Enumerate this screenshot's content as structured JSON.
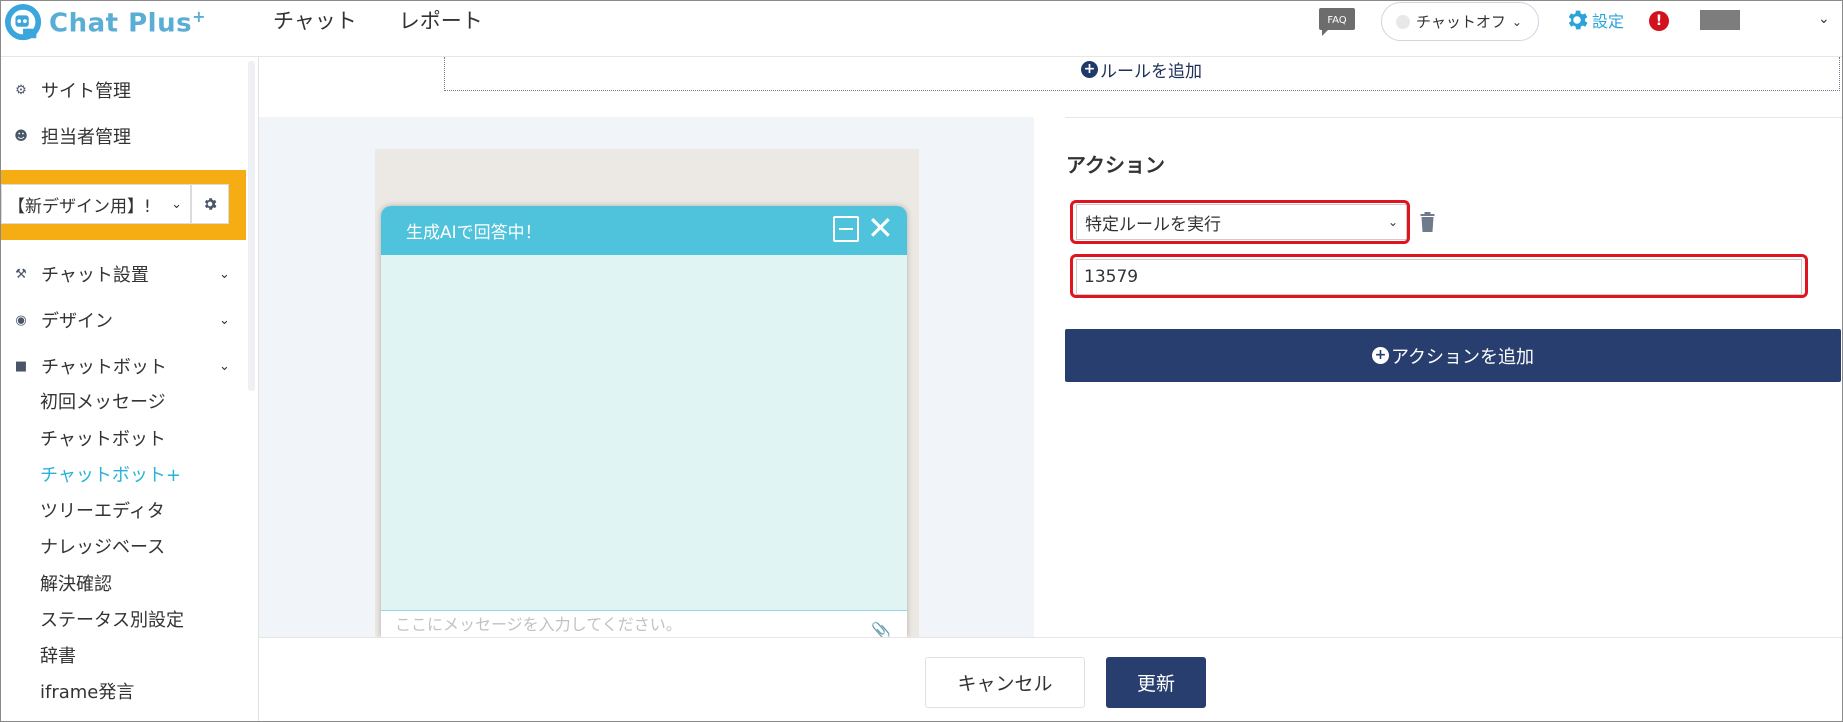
{
  "app": {
    "brand": "Chat Plus",
    "brand_sup": "+",
    "top_nav": [
      "チャット",
      "レポート"
    ],
    "faq_label": "FAQ",
    "chat_status": "チャットオフ",
    "settings_label": "設定",
    "alert_glyph": "!"
  },
  "sidebar": {
    "top_items": [
      {
        "label": "サイト管理",
        "icon": "gears-icon"
      },
      {
        "label": "担当者管理",
        "icon": "user-gear-icon"
      }
    ],
    "site_select": "【新デザイン用】!",
    "sections": [
      {
        "label": "チャット設置",
        "icon": "tools-icon"
      },
      {
        "label": "デザイン",
        "icon": "palette-icon"
      },
      {
        "label": "チャットボット",
        "icon": "chat-bubbles-icon"
      }
    ],
    "sub_items": [
      {
        "label": "初回メッセージ",
        "active": false
      },
      {
        "label": "チャットボット",
        "active": false
      },
      {
        "label": "チャットボット+",
        "active": true
      },
      {
        "label": "ツリーエディタ",
        "active": false
      },
      {
        "label": "ナレッジベース",
        "active": false
      },
      {
        "label": "解決確認",
        "active": false
      },
      {
        "label": "ステータス別設定",
        "active": false
      },
      {
        "label": "辞書",
        "active": false
      },
      {
        "label": "iframe発言",
        "active": false
      }
    ]
  },
  "main": {
    "add_rule_label": "ルールを追加",
    "preview": {
      "header_title": "生成AIで回答中！",
      "input_placeholder": "ここにメッセージを入力してください。"
    },
    "action": {
      "title": "アクション",
      "select_value": "特定ルールを実行",
      "input_value": "13579",
      "add_action_label": "アクションを追加"
    },
    "footer": {
      "cancel_label": "キャンセル",
      "update_label": "更新"
    }
  },
  "colors": {
    "accent": "#2ab3d8",
    "primary_button": "#283e6f",
    "highlight_box": "#f6ad13",
    "red_outline": "#e0141e",
    "chat_header": "#4ec3db",
    "chat_body": "#e1f4f4"
  }
}
